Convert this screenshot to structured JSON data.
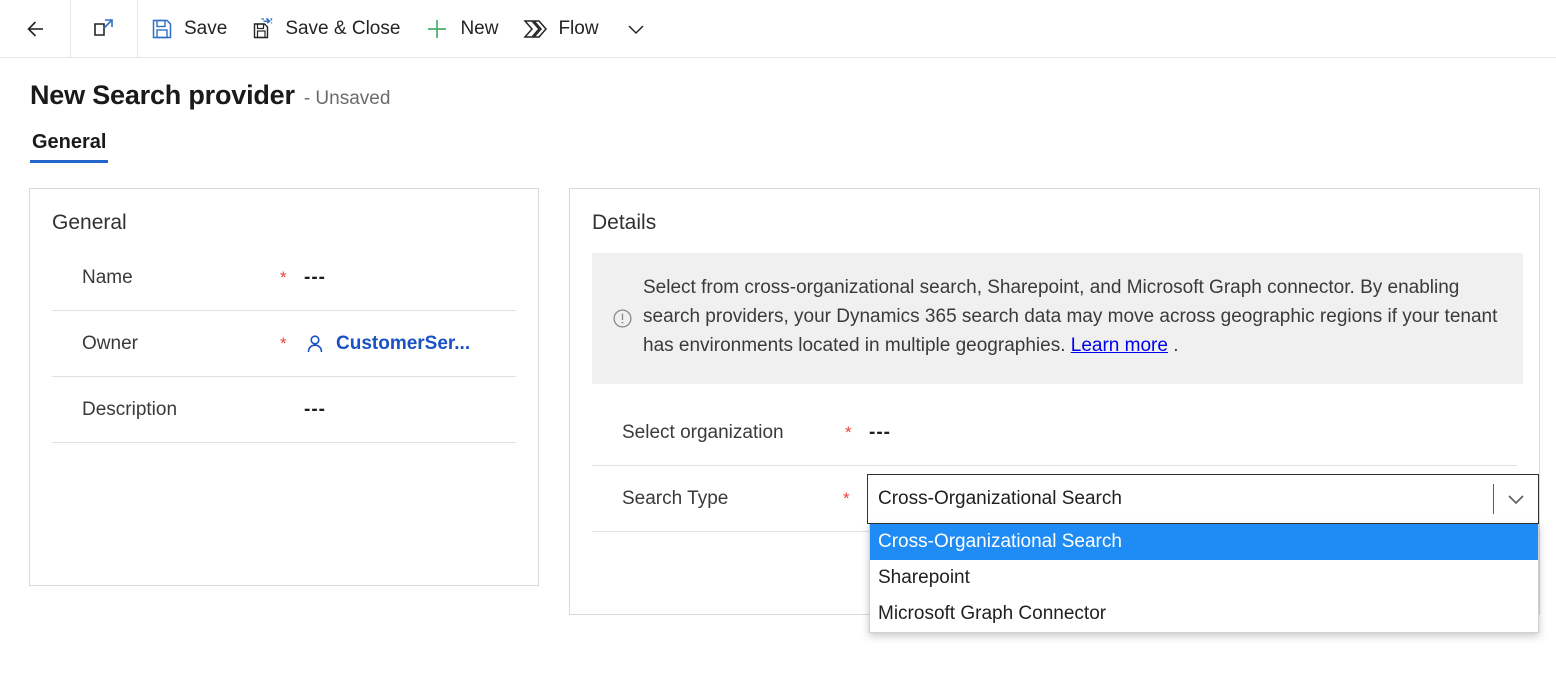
{
  "commandbar": {
    "back": "Back",
    "popout": "Open in new window",
    "items": [
      {
        "id": "save",
        "label": "Save",
        "icon": "save-icon"
      },
      {
        "id": "save-close",
        "label": "Save & Close",
        "icon": "save-and-close-icon"
      },
      {
        "id": "new",
        "label": "New",
        "icon": "plus-icon"
      },
      {
        "id": "flow",
        "label": "Flow",
        "icon": "flow-icon"
      }
    ],
    "overflow": "More commands"
  },
  "record": {
    "title": "New Search provider",
    "state": "- Unsaved"
  },
  "tabs": [
    {
      "id": "general",
      "label": "General",
      "active": true
    }
  ],
  "general_card": {
    "title": "General",
    "fields": [
      {
        "label": "Name",
        "required": "*",
        "value": "---",
        "type": "text"
      },
      {
        "label": "Owner",
        "required": "*",
        "value": "CustomerSer...",
        "type": "lookup",
        "icon": "person-icon"
      },
      {
        "label": "Description",
        "required": "",
        "value": "---",
        "type": "text"
      }
    ]
  },
  "details_card": {
    "title": "Details",
    "banner": {
      "icon": "info-circle-icon",
      "text_before_link": "Select from cross-organizational search, Sharepoint, and Microsoft Graph connector. By enabling search providers, your Dynamics 365 search data may move across geographic regions if your tenant has environments located in multiple geographies. ",
      "link_label": "Learn more",
      "text_after_link": " ."
    },
    "fields": [
      {
        "label": "Select organization",
        "required": "*",
        "value": "---",
        "type": "text"
      },
      {
        "label": "Search Type",
        "required": "*",
        "value": "Cross-Organizational Search",
        "type": "combobox"
      }
    ]
  },
  "dropdown": {
    "open": true,
    "chevron": "chevron-down-icon",
    "options": [
      {
        "label": "Cross-Organizational Search",
        "selected": true
      },
      {
        "label": "Sharepoint",
        "selected": false
      },
      {
        "label": "Microsoft Graph Connector",
        "selected": false
      }
    ]
  },
  "colors": {
    "accent": "#2266cc",
    "link": "#1a52c4",
    "required": "#e8453c",
    "banner_bg": "#f0f0f0",
    "highlight": "#1f8bf5",
    "hyperlink": "#0000ee",
    "new_icon": "#4cae6b",
    "save_icon": "#2d6fc4"
  }
}
